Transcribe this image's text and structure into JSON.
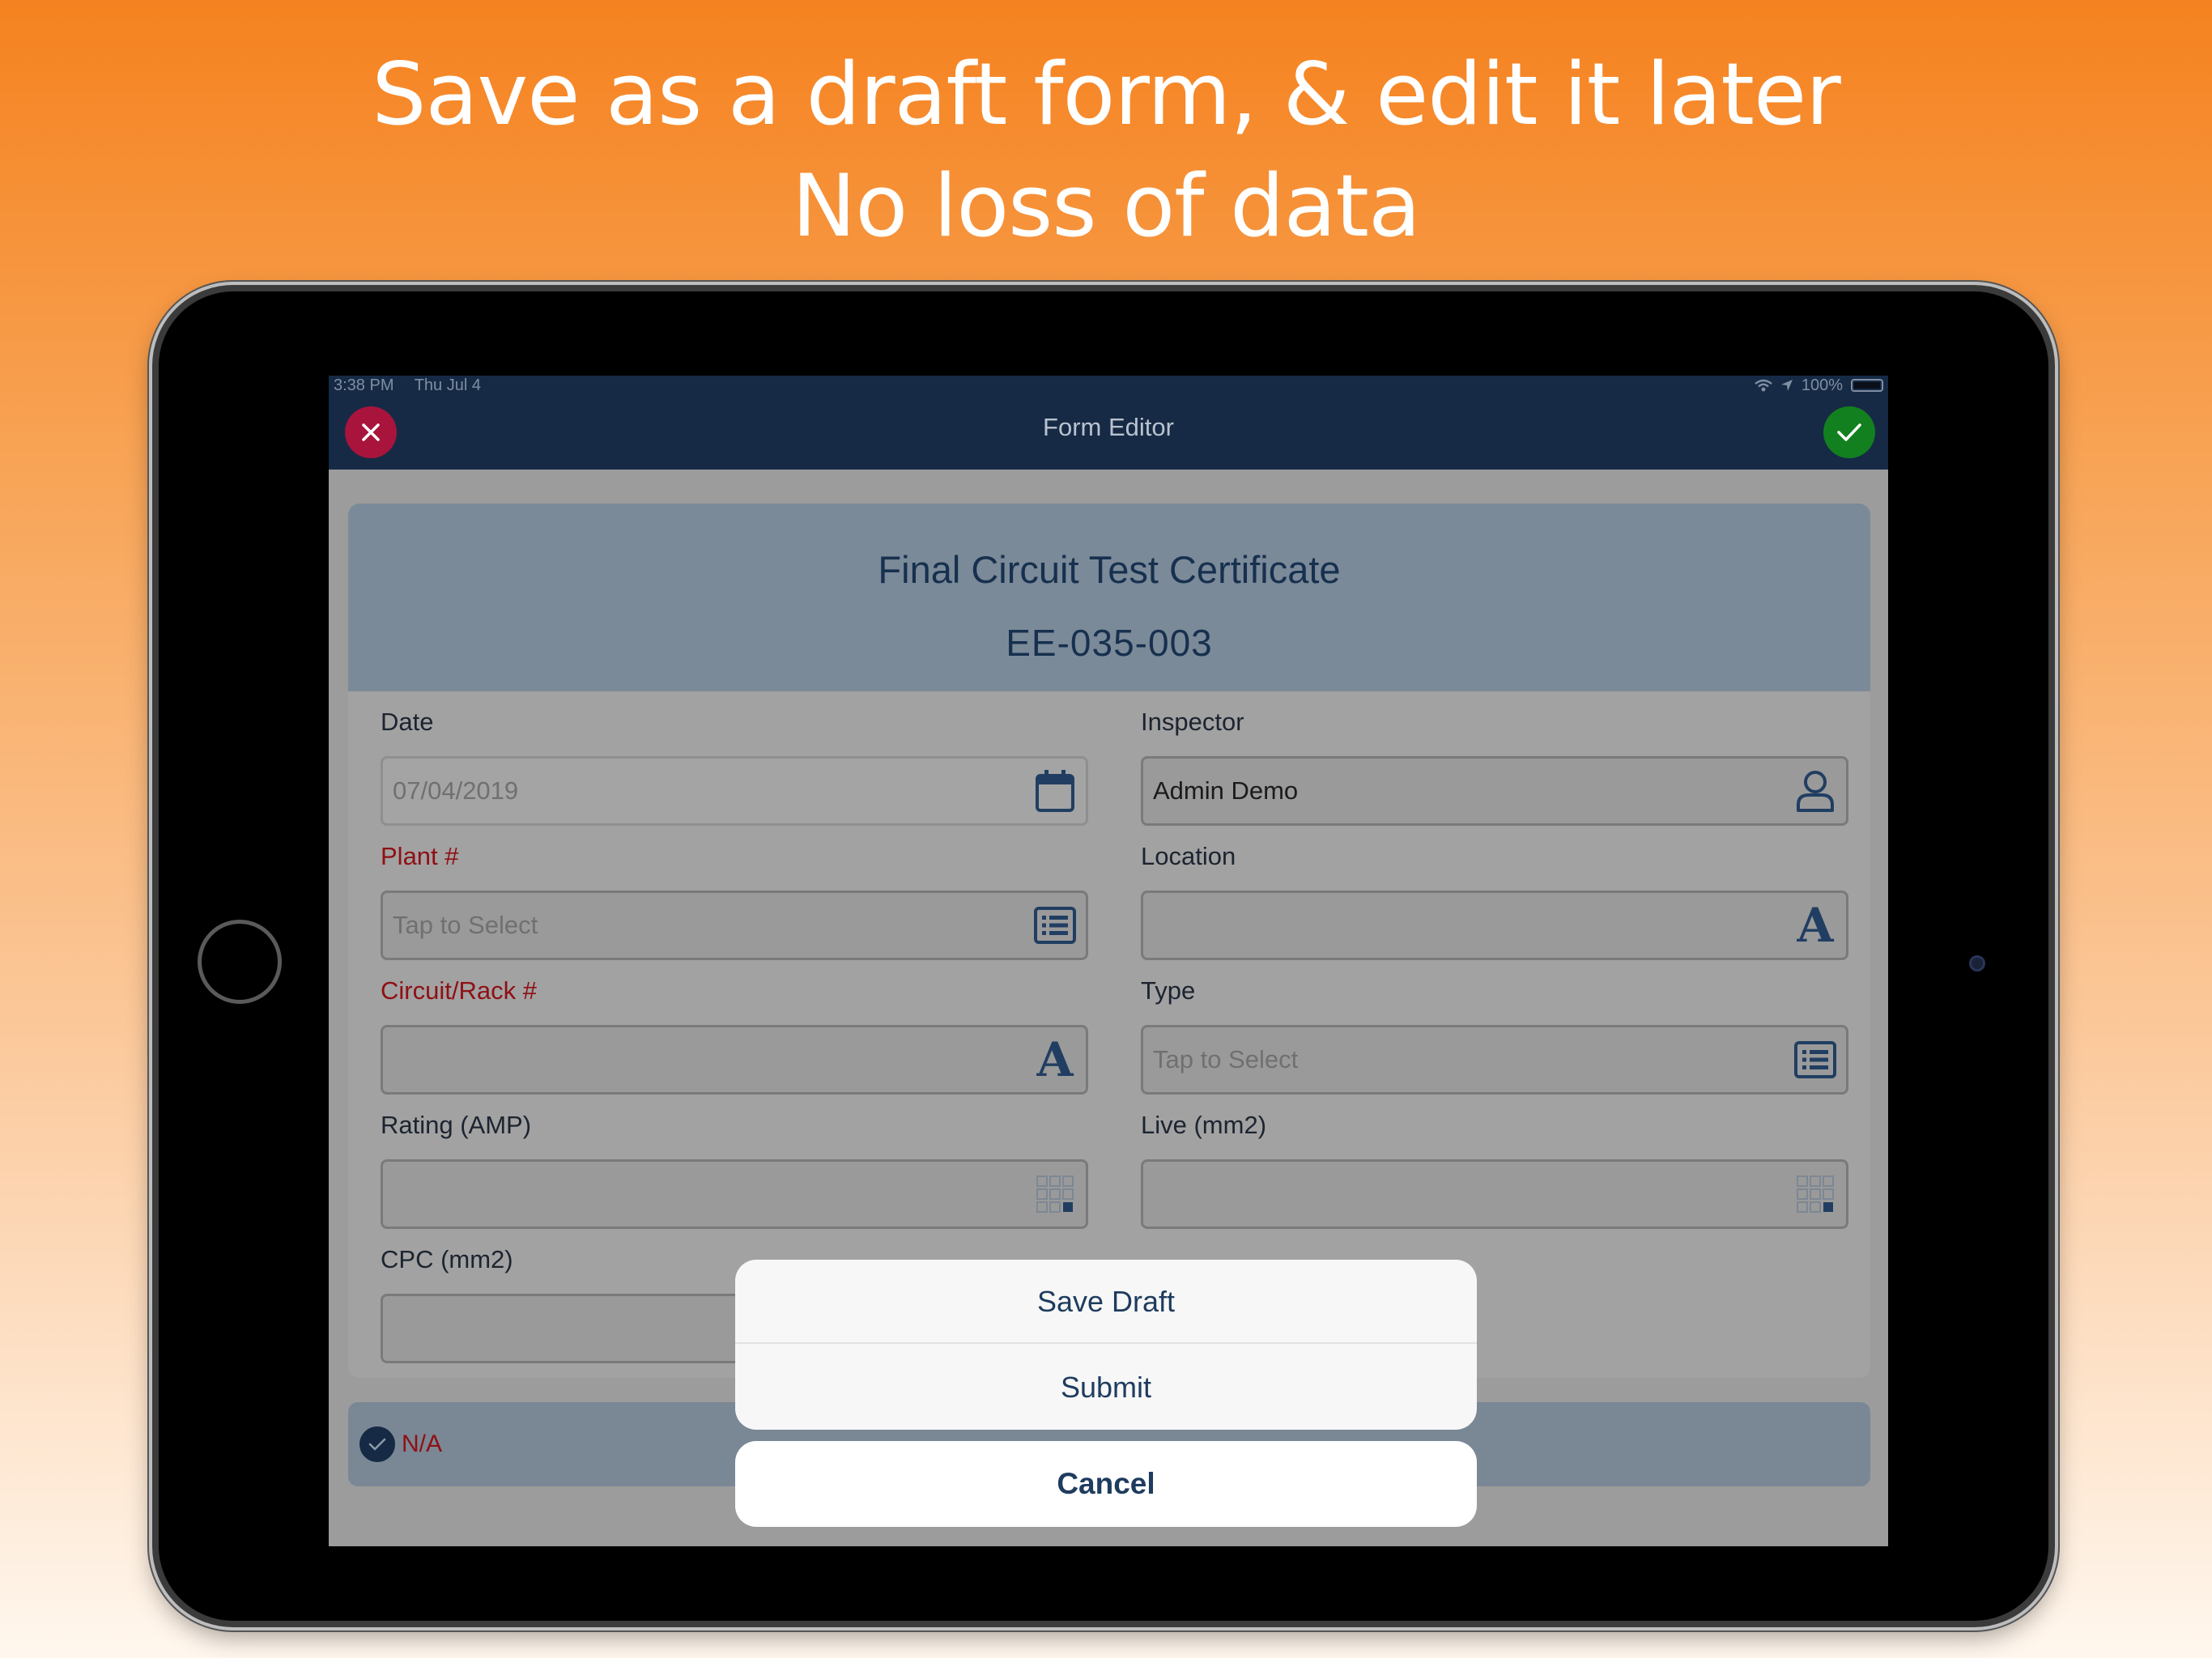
{
  "headline": {
    "line1": "Save as a draft form, & edit it later",
    "line2": "No loss of data"
  },
  "status_bar": {
    "time": "3:38 PM",
    "date": "Thu Jul 4",
    "battery": "100%",
    "icons": [
      "wifi-icon",
      "location-arrow-icon",
      "battery-icon"
    ]
  },
  "nav": {
    "title": "Form Editor",
    "close_icon": "close-icon",
    "done_icon": "checkmark-icon"
  },
  "form": {
    "title": "Final Circuit Test Certificate",
    "code": "EE-035-003",
    "fields": {
      "date": {
        "label": "Date",
        "value": "07/04/2019",
        "icon": "calendar-icon"
      },
      "inspector": {
        "label": "Inspector",
        "value": "Admin Demo",
        "icon": "person-icon"
      },
      "plant": {
        "label": "Plant #",
        "placeholder": "Tap to Select",
        "icon": "list-icon",
        "required": true
      },
      "location": {
        "label": "Location",
        "value": "",
        "icon": "text-icon"
      },
      "circuit": {
        "label": "Circuit/Rack #",
        "value": "",
        "icon": "text-icon",
        "required": true
      },
      "type": {
        "label": "Type",
        "placeholder": "Tap to Select",
        "icon": "list-icon"
      },
      "rating": {
        "label": "Rating (AMP)",
        "value": "",
        "icon": "numpad-icon"
      },
      "live": {
        "label": "Live (mm2)",
        "value": "",
        "icon": "numpad-icon"
      },
      "cpc": {
        "label": "CPC (mm2)",
        "value": ""
      }
    },
    "section": {
      "na_label": "N/A",
      "na_checked": true
    }
  },
  "action_sheet": {
    "save_draft": "Save Draft",
    "submit": "Submit",
    "cancel": "Cancel"
  },
  "colors": {
    "background_top": "#f5821f",
    "navbar": "#162a45",
    "close": "#a8143c",
    "done": "#12801f",
    "required_label": "#8f0f14",
    "accent_text": "#1e3c5e"
  }
}
